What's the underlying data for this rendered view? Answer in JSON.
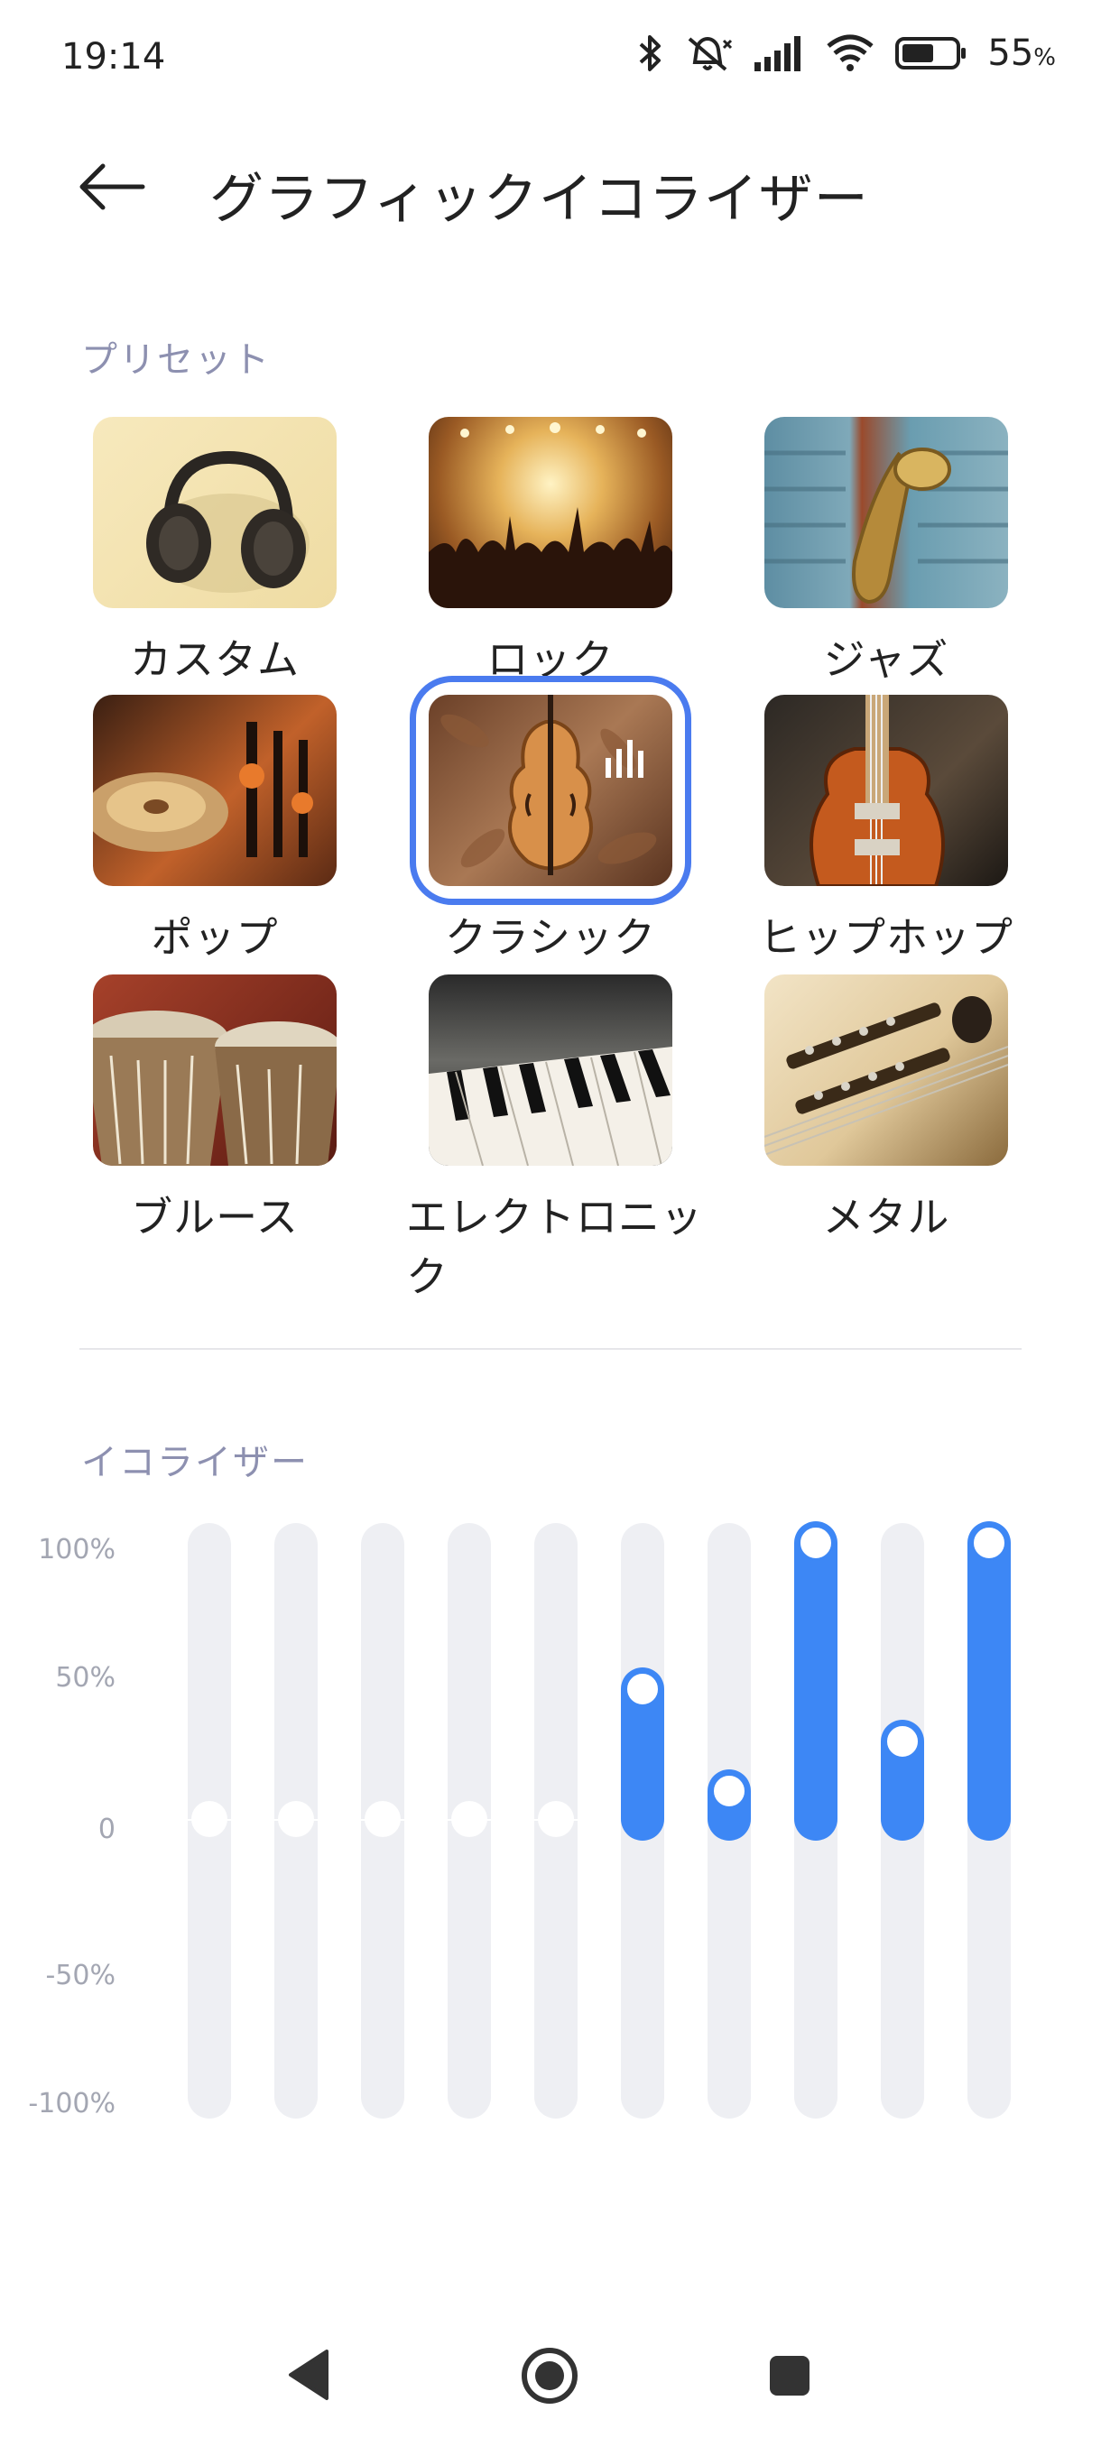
{
  "status": {
    "time": "19:14",
    "battery": "55",
    "battery_unit": "%",
    "icons": [
      "bluetooth-icon",
      "silent-icon",
      "signal-icon",
      "wifi-icon",
      "battery-icon"
    ]
  },
  "header": {
    "title": "グラフィックイコライザー"
  },
  "presets": {
    "section_label": "プリセット",
    "selected": "クラシック",
    "items": [
      {
        "label": "カスタム"
      },
      {
        "label": "ロック"
      },
      {
        "label": "ジャズ"
      },
      {
        "label": "ポップ"
      },
      {
        "label": "クラシック"
      },
      {
        "label": "ヒップホップ"
      },
      {
        "label": "ブルース"
      },
      {
        "label": "エレクトロニック"
      },
      {
        "label": "メタル"
      }
    ]
  },
  "equalizer": {
    "section_label": "イコライザー",
    "ticks": [
      "100%",
      "50%",
      "0",
      "-50%",
      "-100%"
    ],
    "bands_percent": [
      0,
      0,
      0,
      0,
      0,
      47,
      10,
      100,
      28,
      100
    ],
    "accent_color": "#3d87f5"
  },
  "nav": {
    "icons": [
      "back-triangle-icon",
      "home-circle-icon",
      "recents-square-icon"
    ]
  }
}
